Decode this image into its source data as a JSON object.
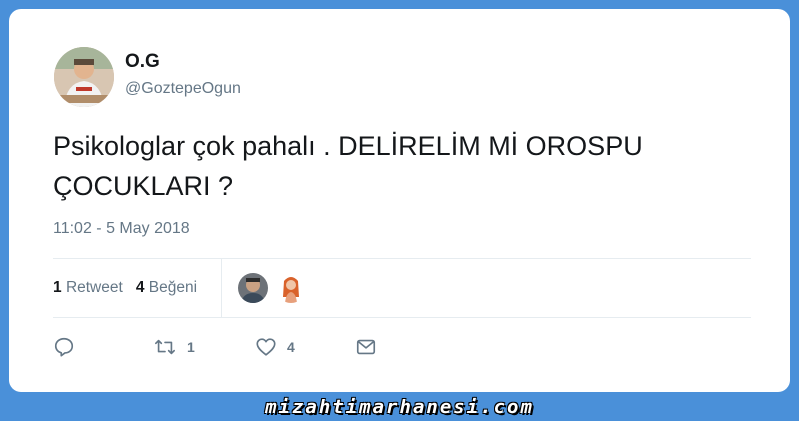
{
  "tweet": {
    "author_name": "O.G",
    "author_handle": "@GoztepeOgun",
    "text": "Psikologlar çok pahalı . DELİRELİM Mİ OROSPU ÇOCUKLARI ?",
    "timestamp": "11:02 - 5 May 2018",
    "stats": {
      "retweet_count": "1",
      "retweet_label": "Retweet",
      "like_count": "4",
      "like_label": "Beğeni"
    },
    "actions": {
      "reply_icon": "reply-icon",
      "retweet_icon": "retweet-icon",
      "retweet_count": "1",
      "like_icon": "heart-icon",
      "like_count": "4",
      "dm_icon": "envelope-icon"
    }
  },
  "watermark": "mizahtimarhanesi.com",
  "colors": {
    "background": "#4a90d9",
    "card": "#ffffff",
    "text": "#14171a",
    "muted": "#657786",
    "divider": "#e6ecf0"
  }
}
